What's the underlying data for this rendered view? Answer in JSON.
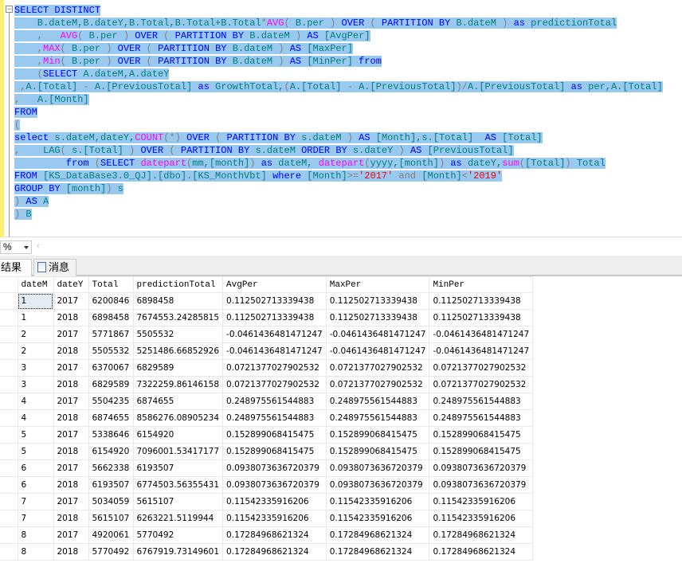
{
  "editor": {
    "lines": [
      [
        [
          "k",
          "SELECT DISTINCT"
        ]
      ],
      [
        [
          "i",
          "    B.dateM,B.dateY,B.Total,B.Total+B.Total"
        ],
        [
          "g",
          "*"
        ],
        [
          "f",
          "AVG"
        ],
        [
          "g",
          "( "
        ],
        [
          "i",
          "B.per"
        ],
        [
          "g",
          " ) "
        ],
        [
          "k",
          "OVER"
        ],
        [
          "g",
          " ( "
        ],
        [
          "k",
          "PARTITION BY"
        ],
        [
          "i",
          " B.dateM"
        ],
        [
          "g",
          " ) "
        ],
        [
          "k",
          "as"
        ],
        [
          "i",
          " predictionTotal"
        ]
      ],
      [
        [
          "g",
          "    ,   "
        ],
        [
          "f",
          "AVG"
        ],
        [
          "g",
          "( "
        ],
        [
          "i",
          "B.per"
        ],
        [
          "g",
          " ) "
        ],
        [
          "k",
          "OVER"
        ],
        [
          "g",
          " ( "
        ],
        [
          "k",
          "PARTITION BY"
        ],
        [
          "i",
          " B.dateM"
        ],
        [
          "g",
          " ) "
        ],
        [
          "k",
          "AS"
        ],
        [
          "i",
          " [AvgPer]"
        ]
      ],
      [
        [
          "g",
          "    ,"
        ],
        [
          "f",
          "MAX"
        ],
        [
          "g",
          "( "
        ],
        [
          "i",
          "B.per"
        ],
        [
          "g",
          " ) "
        ],
        [
          "k",
          "OVER"
        ],
        [
          "g",
          " ( "
        ],
        [
          "k",
          "PARTITION BY"
        ],
        [
          "i",
          " B.dateM"
        ],
        [
          "g",
          " ) "
        ],
        [
          "k",
          "AS"
        ],
        [
          "i",
          " [MaxPer]"
        ]
      ],
      [
        [
          "g",
          "    ,"
        ],
        [
          "f",
          "Min"
        ],
        [
          "g",
          "( "
        ],
        [
          "i",
          "B.per"
        ],
        [
          "g",
          " ) "
        ],
        [
          "k",
          "OVER"
        ],
        [
          "g",
          " ( "
        ],
        [
          "k",
          "PARTITION BY"
        ],
        [
          "i",
          " B.dateM"
        ],
        [
          "g",
          " ) "
        ],
        [
          "k",
          "AS"
        ],
        [
          "i",
          " [MinPer] "
        ],
        [
          "k",
          "from"
        ]
      ],
      [
        [
          "g",
          "    ("
        ],
        [
          "k",
          "SELECT"
        ],
        [
          "i",
          " A.dateM,A.dateY"
        ]
      ],
      [
        [
          "g",
          " ,"
        ],
        [
          "i",
          "A.[Total] "
        ],
        [
          "g",
          "-"
        ],
        [
          "i",
          " A.[PreviousTotal] "
        ],
        [
          "k",
          "as"
        ],
        [
          "i",
          " GrowthTotal,"
        ],
        [
          "g",
          "("
        ],
        [
          "i",
          "A.[Total] "
        ],
        [
          "g",
          "-"
        ],
        [
          "i",
          " A.[PreviousTotal]"
        ],
        [
          "g",
          ")/"
        ],
        [
          "i",
          "A.[PreviousTotal] "
        ],
        [
          "k",
          "as"
        ],
        [
          "i",
          " per,A.[Total]"
        ]
      ],
      [
        [
          "g",
          ",   "
        ],
        [
          "i",
          "A.[Month]"
        ]
      ],
      [
        [
          "k",
          "FROM"
        ]
      ],
      [
        [
          "g",
          "("
        ]
      ],
      [
        [
          "k",
          "select"
        ],
        [
          "i",
          " s.dateM,dateY,"
        ],
        [
          "f",
          "COUNT"
        ],
        [
          "g",
          "(*) "
        ],
        [
          "k",
          "OVER"
        ],
        [
          "g",
          " ( "
        ],
        [
          "k",
          "PARTITION BY"
        ],
        [
          "i",
          " s.dateM "
        ],
        [
          "g",
          ") "
        ],
        [
          "k",
          "AS"
        ],
        [
          "i",
          " [Month],s.[Total]  "
        ],
        [
          "k",
          "AS"
        ],
        [
          "i",
          " [Total]"
        ]
      ],
      [
        [
          "g",
          ",    "
        ],
        [
          "i",
          "LAG"
        ],
        [
          "g",
          "( "
        ],
        [
          "i",
          "s.[Total] "
        ],
        [
          "g",
          ") "
        ],
        [
          "k",
          "OVER"
        ],
        [
          "g",
          " ( "
        ],
        [
          "k",
          "PARTITION BY"
        ],
        [
          "i",
          " s.dateM "
        ],
        [
          "k",
          "ORDER BY"
        ],
        [
          "i",
          " s.dateY "
        ],
        [
          "g",
          ") "
        ],
        [
          "k",
          "AS"
        ],
        [
          "i",
          " [PreviousTotal]"
        ]
      ],
      [
        [
          "k",
          "         from "
        ],
        [
          "g",
          "("
        ],
        [
          "k",
          "SELECT "
        ],
        [
          "f",
          "datepart"
        ],
        [
          "g",
          "("
        ],
        [
          "i",
          "mm,[month]"
        ],
        [
          "g",
          ") "
        ],
        [
          "k",
          "as"
        ],
        [
          "i",
          " dateM, "
        ],
        [
          "f",
          "datepart"
        ],
        [
          "g",
          "("
        ],
        [
          "i",
          "yyyy,[month]"
        ],
        [
          "g",
          ") "
        ],
        [
          "k",
          "as"
        ],
        [
          "i",
          " dateY,"
        ],
        [
          "f",
          "sum"
        ],
        [
          "g",
          "("
        ],
        [
          "i",
          "[Total]"
        ],
        [
          "g",
          ") "
        ],
        [
          "i",
          "Total"
        ]
      ],
      [
        [
          "k",
          "FROM"
        ],
        [
          "i",
          " [KS_DataBase3.0_QJ].[dbo].[KS_MonthVbt] "
        ],
        [
          "k",
          "where"
        ],
        [
          "i",
          " [Month]"
        ],
        [
          "g",
          ">="
        ],
        [
          "s",
          "'2017' "
        ],
        [
          "g",
          "and"
        ],
        [
          "i",
          " [Month]"
        ],
        [
          "g",
          "<"
        ],
        [
          "s",
          "'2019'"
        ]
      ],
      [
        [
          "k",
          "GROUP BY"
        ],
        [
          "i",
          " [month]"
        ],
        [
          "g",
          ") "
        ],
        [
          "i",
          "s"
        ]
      ],
      [
        [
          "g",
          ") "
        ],
        [
          "k",
          "AS"
        ],
        [
          "i",
          " A"
        ]
      ],
      [
        [
          "g",
          ") "
        ],
        [
          "i",
          "B"
        ]
      ]
    ]
  },
  "zoom": {
    "value": "%"
  },
  "tabs": {
    "results": "结果",
    "messages": "消息"
  },
  "grid": {
    "columns": [
      "dateM",
      "dateY",
      "Total",
      "predictionTotal",
      "AvgPer",
      "MaxPer",
      "MinPer"
    ],
    "rows": [
      [
        "1",
        "2017",
        "6200846",
        "6898458",
        "0.112502713339438",
        "0.112502713339438",
        "0.112502713339438"
      ],
      [
        "1",
        "2018",
        "6898458",
        "7674553.24285815",
        "0.112502713339438",
        "0.112502713339438",
        "0.112502713339438"
      ],
      [
        "2",
        "2017",
        "5771867",
        "5505532",
        "-0.0461436481471247",
        "-0.0461436481471247",
        "-0.0461436481471247"
      ],
      [
        "2",
        "2018",
        "5505532",
        "5251486.66852926",
        "-0.0461436481471247",
        "-0.0461436481471247",
        "-0.0461436481471247"
      ],
      [
        "3",
        "2017",
        "6370067",
        "6829589",
        "0.0721377027902532",
        "0.0721377027902532",
        "0.0721377027902532"
      ],
      [
        "3",
        "2018",
        "6829589",
        "7322259.86146158",
        "0.0721377027902532",
        "0.0721377027902532",
        "0.0721377027902532"
      ],
      [
        "4",
        "2017",
        "5504235",
        "6874655",
        "0.248975561544883",
        "0.248975561544883",
        "0.248975561544883"
      ],
      [
        "4",
        "2018",
        "6874655",
        "8586276.08905234",
        "0.248975561544883",
        "0.248975561544883",
        "0.248975561544883"
      ],
      [
        "5",
        "2017",
        "5338646",
        "6154920",
        "0.152899068415475",
        "0.152899068415475",
        "0.152899068415475"
      ],
      [
        "5",
        "2018",
        "6154920",
        "7096001.53417177",
        "0.152899068415475",
        "0.152899068415475",
        "0.152899068415475"
      ],
      [
        "6",
        "2017",
        "5662338",
        "6193507",
        "0.0938073636720379",
        "0.0938073636720379",
        "0.0938073636720379"
      ],
      [
        "6",
        "2018",
        "6193507",
        "6774503.56355431",
        "0.0938073636720379",
        "0.0938073636720379",
        "0.0938073636720379"
      ],
      [
        "7",
        "2017",
        "5034059",
        "5615107",
        "0.11542335916206",
        "0.11542335916206",
        "0.11542335916206"
      ],
      [
        "7",
        "2018",
        "5615107",
        "6263221.5119944",
        "0.11542335916206",
        "0.11542335916206",
        "0.11542335916206"
      ],
      [
        "8",
        "2017",
        "4920061",
        "5770492",
        "0.17284968621324",
        "0.17284968621324",
        "0.17284968621324"
      ],
      [
        "8",
        "2018",
        "5770492",
        "6767919.73149601",
        "0.17284968621324",
        "0.17284968621324",
        "0.17284968621324"
      ]
    ]
  }
}
